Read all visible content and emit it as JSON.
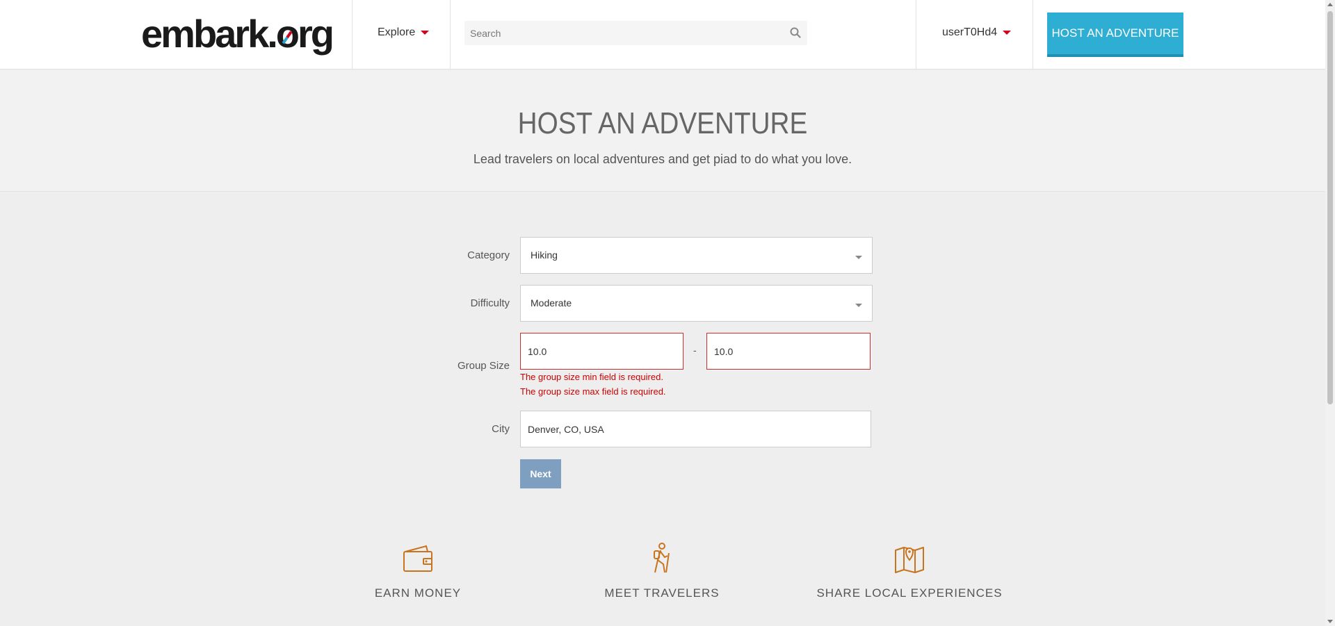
{
  "header": {
    "logo_text_pre": "embark.",
    "logo_text_o": "o",
    "logo_text_post": "rg",
    "explore_label": "Explore",
    "search_placeholder": "Search",
    "username": "userT0Hd4",
    "host_button_label": "HOST AN ADVENTURE"
  },
  "hero": {
    "title": "HOST AN ADVENTURE",
    "subtitle": "Lead travelers on local adventures and get piad to do what you love."
  },
  "form": {
    "category_label": "Category",
    "category_value": "Hiking",
    "difficulty_label": "Difficulty",
    "difficulty_value": "Moderate",
    "group_size_label": "Group Size",
    "group_size_min": "10.0",
    "group_size_max": "10.0",
    "group_size_separator": "-",
    "error_min": "The group size min field is required.",
    "error_max": "The group size max field is required.",
    "city_label": "City",
    "city_value": "Denver, CO, USA",
    "next_label": "Next"
  },
  "features": [
    {
      "title": "EARN MONEY",
      "icon": "wallet-icon"
    },
    {
      "title": "MEET TRAVELERS",
      "icon": "hiker-icon"
    },
    {
      "title": "SHARE LOCAL EXPERIENCES",
      "icon": "map-pin-icon"
    }
  ],
  "colors": {
    "accent_red": "#d0021b",
    "host_button_blue": "#2eaed3",
    "feature_icon_orange": "#c8731e",
    "error_red": "#cc0000",
    "next_button": "#7f9fc0"
  }
}
